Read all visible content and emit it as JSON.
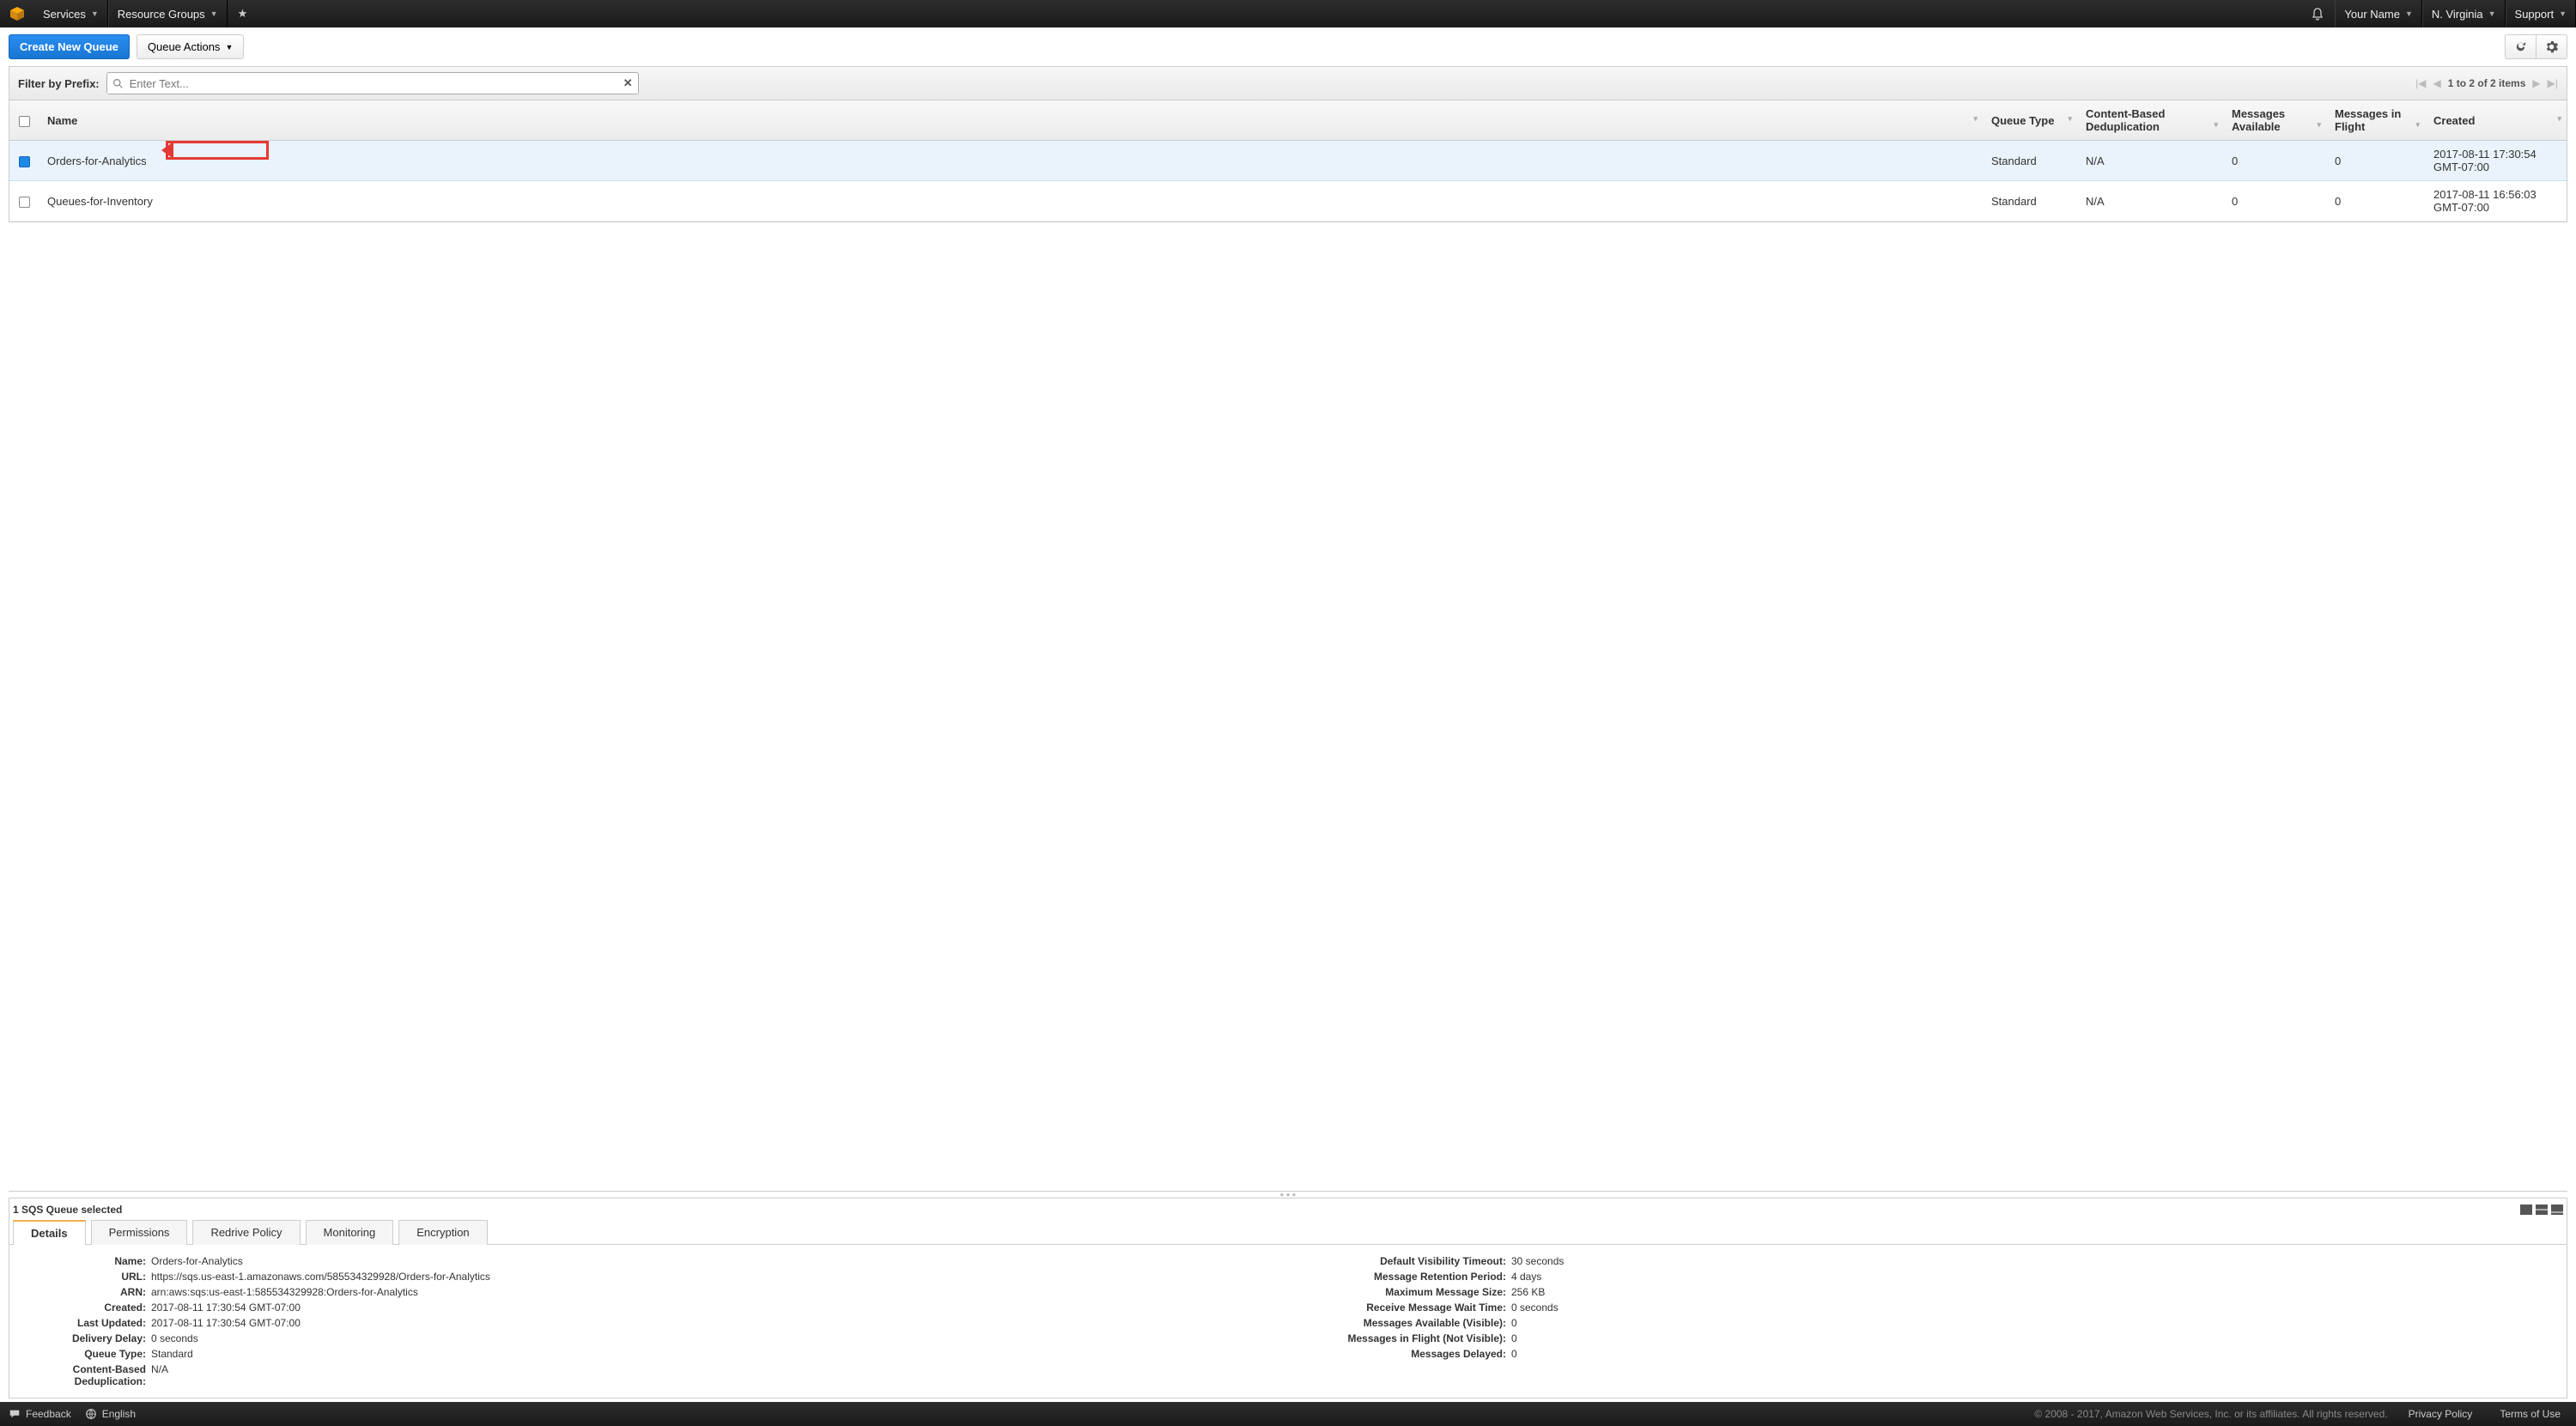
{
  "topnav": {
    "services": "Services",
    "resource_groups": "Resource Groups",
    "your_name": "Your Name",
    "region": "N. Virginia",
    "support": "Support"
  },
  "toolbar": {
    "create": "Create New Queue",
    "actions": "Queue Actions"
  },
  "filter": {
    "label": "Filter by Prefix:",
    "placeholder": "Enter Text...",
    "paging": "1 to 2 of 2 items"
  },
  "columns": {
    "name": "Name",
    "queue_type": "Queue Type",
    "cbd": "Content-Based Deduplication",
    "msgs_avail": "Messages Available",
    "msgs_flight": "Messages in Flight",
    "created": "Created"
  },
  "rows": [
    {
      "selected": true,
      "name": "Orders-for-Analytics",
      "queue_type": "Standard",
      "cbd": "N/A",
      "msgs_avail": "0",
      "msgs_flight": "0",
      "created": "2017-08-11 17:30:54 GMT-07:00"
    },
    {
      "selected": false,
      "name": "Queues-for-Inventory",
      "queue_type": "Standard",
      "cbd": "N/A",
      "msgs_avail": "0",
      "msgs_flight": "0",
      "created": "2017-08-11 16:56:03 GMT-07:00"
    }
  ],
  "selection_text": "1 SQS Queue selected",
  "tabs": {
    "details": "Details",
    "permissions": "Permissions",
    "redrive": "Redrive Policy",
    "monitoring": "Monitoring",
    "encryption": "Encryption"
  },
  "details": {
    "left": {
      "name_l": "Name:",
      "name_v": "Orders-for-Analytics",
      "url_l": "URL:",
      "url_v": "https://sqs.us-east-1.amazonaws.com/585534329928/Orders-for-Analytics",
      "arn_l": "ARN:",
      "arn_v": "arn:aws:sqs:us-east-1:585534329928:Orders-for-Analytics",
      "created_l": "Created:",
      "created_v": "2017-08-11 17:30:54 GMT-07:00",
      "updated_l": "Last Updated:",
      "updated_v": "2017-08-11 17:30:54 GMT-07:00",
      "delay_l": "Delivery Delay:",
      "delay_v": "0 seconds",
      "qtype_l": "Queue Type:",
      "qtype_v": "Standard",
      "cbd_l": "Content-Based Deduplication:",
      "cbd_v": "N/A"
    },
    "right": {
      "vis_l": "Default Visibility Timeout:",
      "vis_v": "30 seconds",
      "ret_l": "Message Retention Period:",
      "ret_v": "4 days",
      "max_l": "Maximum Message Size:",
      "max_v": "256 KB",
      "wait_l": "Receive Message Wait Time:",
      "wait_v": "0 seconds",
      "avail_l": "Messages Available (Visible):",
      "avail_v": "0",
      "flight_l": "Messages in Flight (Not Visible):",
      "flight_v": "0",
      "delayed_l": "Messages Delayed:",
      "delayed_v": "0"
    }
  },
  "footer": {
    "feedback": "Feedback",
    "language": "English",
    "copyright": "© 2008 - 2017, Amazon Web Services, Inc. or its affiliates. All rights reserved.",
    "privacy": "Privacy Policy",
    "terms": "Terms of Use"
  }
}
